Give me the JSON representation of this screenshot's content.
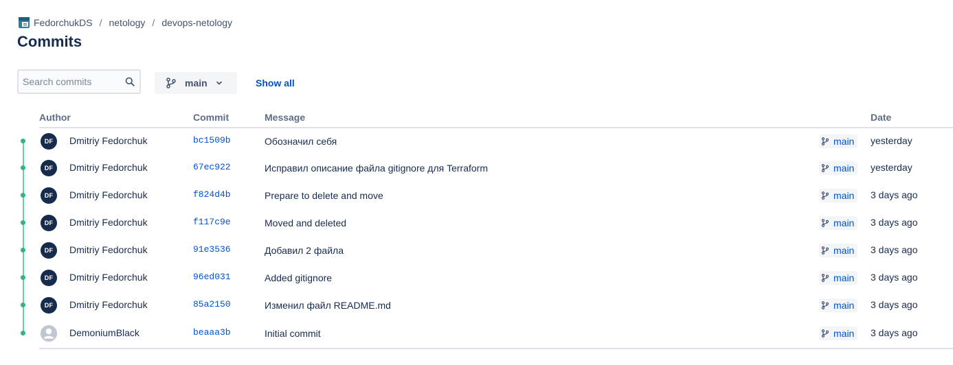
{
  "breadcrumb": {
    "workspace": "FedorchukDS",
    "project": "netology",
    "repo": "devops-netology",
    "separator": "/"
  },
  "page_title": "Commits",
  "toolbar": {
    "search_placeholder": "Search commits",
    "branch": "main",
    "show_all": "Show all"
  },
  "table": {
    "headers": {
      "author": "Author",
      "commit": "Commit",
      "message": "Message",
      "date": "Date"
    },
    "rows": [
      {
        "initials": "DF",
        "avatar_style": "initials",
        "author": "Dmitriy Fedorchuk",
        "hash": "bc1509b",
        "message": "Обозначил себя",
        "branch": "main",
        "date": "yesterday"
      },
      {
        "initials": "DF",
        "avatar_style": "initials",
        "author": "Dmitriy Fedorchuk",
        "hash": "67ec922",
        "message": "Исправил описание файла gitignore для Terraform",
        "branch": "main",
        "date": "yesterday"
      },
      {
        "initials": "DF",
        "avatar_style": "initials",
        "author": "Dmitriy Fedorchuk",
        "hash": "f824d4b",
        "message": "Prepare to delete and move",
        "branch": "main",
        "date": "3 days ago"
      },
      {
        "initials": "DF",
        "avatar_style": "initials",
        "author": "Dmitriy Fedorchuk",
        "hash": "f117c9e",
        "message": "Moved and deleted",
        "branch": "main",
        "date": "3 days ago"
      },
      {
        "initials": "DF",
        "avatar_style": "initials",
        "author": "Dmitriy Fedorchuk",
        "hash": "91e3536",
        "message": "Добавил 2 файла",
        "branch": "main",
        "date": "3 days ago"
      },
      {
        "initials": "DF",
        "avatar_style": "initials",
        "author": "Dmitriy Fedorchuk",
        "hash": "96ed031",
        "message": "Added gitignore",
        "branch": "main",
        "date": "3 days ago"
      },
      {
        "initials": "DF",
        "avatar_style": "initials",
        "author": "Dmitriy Fedorchuk",
        "hash": "85a2150",
        "message": "Изменил файл README.md",
        "branch": "main",
        "date": "3 days ago"
      },
      {
        "initials": "",
        "avatar_style": "default-user-icon",
        "author": "DemoniumBlack",
        "hash": "beaaa3b",
        "message": "Initial commit",
        "branch": "main",
        "date": "3 days ago"
      }
    ]
  },
  "colors": {
    "accent": "#0052cc",
    "graph": "#36b37e",
    "text": "#172b4d",
    "avatar": "#172b4d"
  },
  "icons": [
    "workspace-logo-icon",
    "search-icon",
    "branch-icon",
    "chevron-down-icon",
    "default-user-icon"
  ]
}
